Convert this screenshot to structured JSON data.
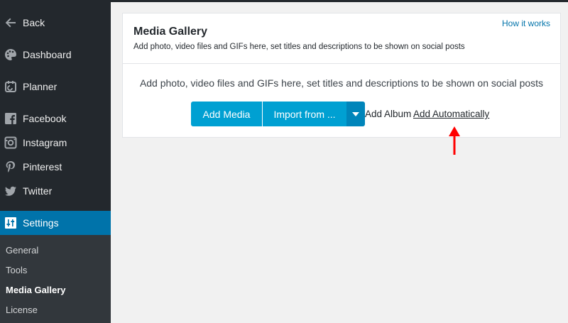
{
  "sidebar": {
    "items": [
      {
        "label": "Back",
        "icon": "arrow-left-icon"
      },
      {
        "label": "Dashboard",
        "icon": "palette-icon"
      },
      {
        "label": "Planner",
        "icon": "calendar-icon"
      },
      {
        "label": "Facebook",
        "icon": "facebook-icon"
      },
      {
        "label": "Instagram",
        "icon": "instagram-icon"
      },
      {
        "label": "Pinterest",
        "icon": "pinterest-icon"
      },
      {
        "label": "Twitter",
        "icon": "twitter-icon"
      },
      {
        "label": "Settings",
        "icon": "settings-icon"
      }
    ],
    "submenu": [
      {
        "label": "General"
      },
      {
        "label": "Tools"
      },
      {
        "label": "Media Gallery"
      },
      {
        "label": "License"
      }
    ]
  },
  "panel": {
    "title": "Media Gallery",
    "subtitle": "Add photo, video files and GIFs here, set titles and descriptions to be shown on social posts",
    "how_link": "How it works",
    "message": "Add photo, video files and GIFs here, set titles and descriptions to be shown on social posts",
    "add_media_label": "Add Media",
    "import_label": "Import from ...",
    "add_album_label": "Add Album",
    "add_auto_label": "Add Automatically"
  },
  "colors": {
    "sidebar_bg": "#23282d",
    "active_bg": "#0073aa",
    "button_bg": "#00a0d2",
    "annotation_arrow": "#ff0000"
  }
}
